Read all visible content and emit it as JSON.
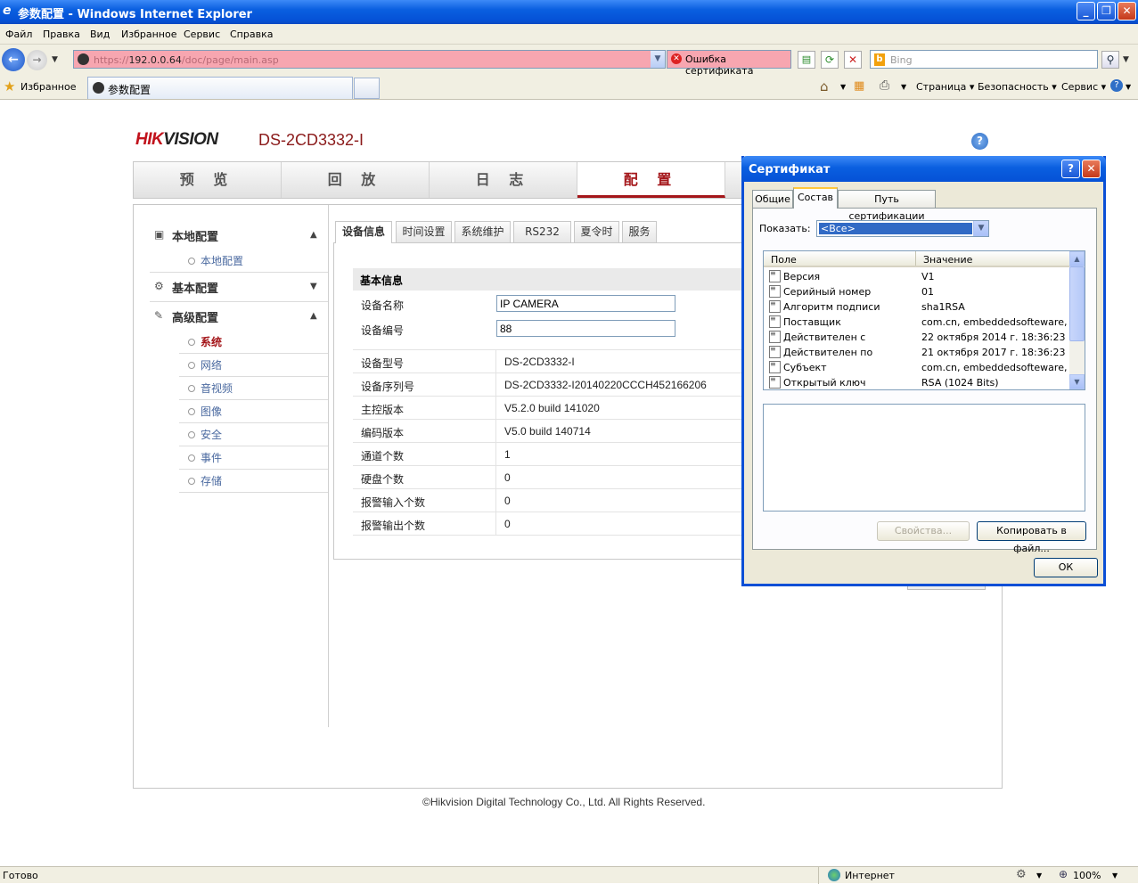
{
  "window": {
    "title": "参数配置 - Windows Internet Explorer"
  },
  "menu": [
    "Файл",
    "Правка",
    "Вид",
    "Избранное",
    "Сервис",
    "Справка"
  ],
  "address": {
    "url_prefix": "https://",
    "url_host": "192.0.0.64",
    "url_path": "/doc/page/main.asp",
    "cert_error": "Ошибка сертификата",
    "search_placeholder": "Bing"
  },
  "favorites": {
    "label": "Избранное",
    "tab_title": "参数配置"
  },
  "commandbar": {
    "page": "Страница",
    "safety": "Безопасность",
    "tools": "Сервис"
  },
  "page": {
    "logo_hik": "HIK",
    "logo_vision": "VISION",
    "model": "DS-2CD3332-I",
    "help": "?",
    "nav": [
      "预 览",
      "回 放",
      "日 志",
      "配 置"
    ],
    "sidebar": {
      "local": "本地配置",
      "local_sub": "本地配置",
      "basic": "基本配置",
      "advanced": "高级配置",
      "advanced_items": [
        "系统",
        "网络",
        "音视频",
        "图像",
        "安全",
        "事件",
        "存储"
      ]
    },
    "tabs": [
      "设备信息",
      "时间设置",
      "系统维护",
      "RS232",
      "夏令时",
      "服务"
    ],
    "basic_header": "基本信息",
    "device_name_label": "设备名称",
    "device_name": "IP CAMERA",
    "device_no_label": "设备编号",
    "device_no": "88",
    "info": [
      {
        "k": "设备型号",
        "v": "DS-2CD3332-I"
      },
      {
        "k": "设备序列号",
        "v": "DS-2CD3332-I20140220CCCH452166206"
      },
      {
        "k": "主控版本",
        "v": "V5.2.0 build 141020"
      },
      {
        "k": "编码版本",
        "v": "V5.0 build 140714"
      },
      {
        "k": "通道个数",
        "v": "1"
      },
      {
        "k": "硬盘个数",
        "v": "0"
      },
      {
        "k": "报警输入个数",
        "v": "0"
      },
      {
        "k": "报警输出个数",
        "v": "0"
      }
    ],
    "footer": "©Hikvision Digital Technology Co., Ltd. All Rights Reserved."
  },
  "status": {
    "left": "Готово",
    "zone": "Интернет",
    "zoom": "100%"
  },
  "dialog": {
    "title": "Сертификат",
    "tabs": [
      "Общие",
      "Состав",
      "Путь сертификации"
    ],
    "show_label": "Показать:",
    "show_value": "<Все>",
    "col_field": "Поле",
    "col_value": "Значение",
    "rows": [
      {
        "f": "Версия",
        "v": "V1"
      },
      {
        "f": "Серийный номер",
        "v": "01"
      },
      {
        "f": "Алгоритм подписи",
        "v": "sha1RSA"
      },
      {
        "f": "Поставщик",
        "v": "com.cn, embeddedsofteware, ..."
      },
      {
        "f": "Действителен с",
        "v": "22 октября 2014 г. 18:36:23"
      },
      {
        "f": "Действителен по",
        "v": "21 октября 2017 г. 18:36:23"
      },
      {
        "f": "Субъект",
        "v": "com.cn, embeddedsofteware, ..."
      },
      {
        "f": "Открытый ключ",
        "v": "RSA (1024 Bits)"
      }
    ],
    "btn_props": "Свойства...",
    "btn_copy": "Копировать в файл...",
    "btn_ok": "ОК"
  }
}
